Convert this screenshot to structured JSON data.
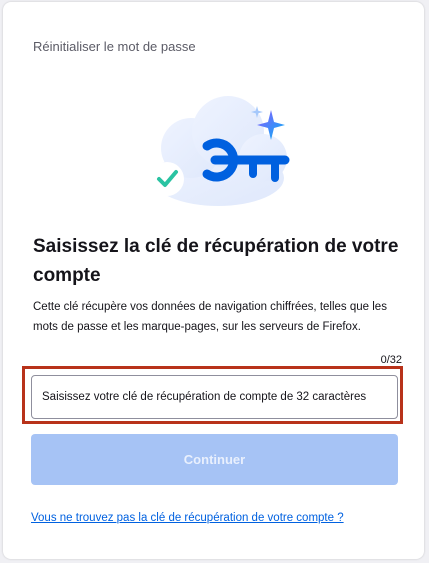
{
  "dialog": {
    "header_label": "Réinitialiser le mot de passe",
    "heading": "Saisissez la clé de récupération de votre compte",
    "description": "Cette clé récupère vos données de navigation chiffrées, telles que les mots de passe et les marque-pages, sur les serveurs de Firefox.",
    "counter": "0/32",
    "input_placeholder": "Saisissez votre clé de récupération de compte de 32 caractères",
    "input_value": "",
    "continue_label": "Continuer",
    "help_link": "Vous ne trouvez pas la clé de récupération de votre compte ?"
  },
  "illustration": {
    "icons": [
      "cloud-icon",
      "key-icon",
      "checkmark-icon",
      "sparkle-icon"
    ]
  },
  "colors": {
    "key_blue": "#0060df",
    "check_green": "#2ac3a2",
    "sparkle_purple": "#9059ff",
    "button_disabled": "#a6c3f5",
    "link_blue": "#0061e0",
    "highlight_border": "#b8321a"
  }
}
